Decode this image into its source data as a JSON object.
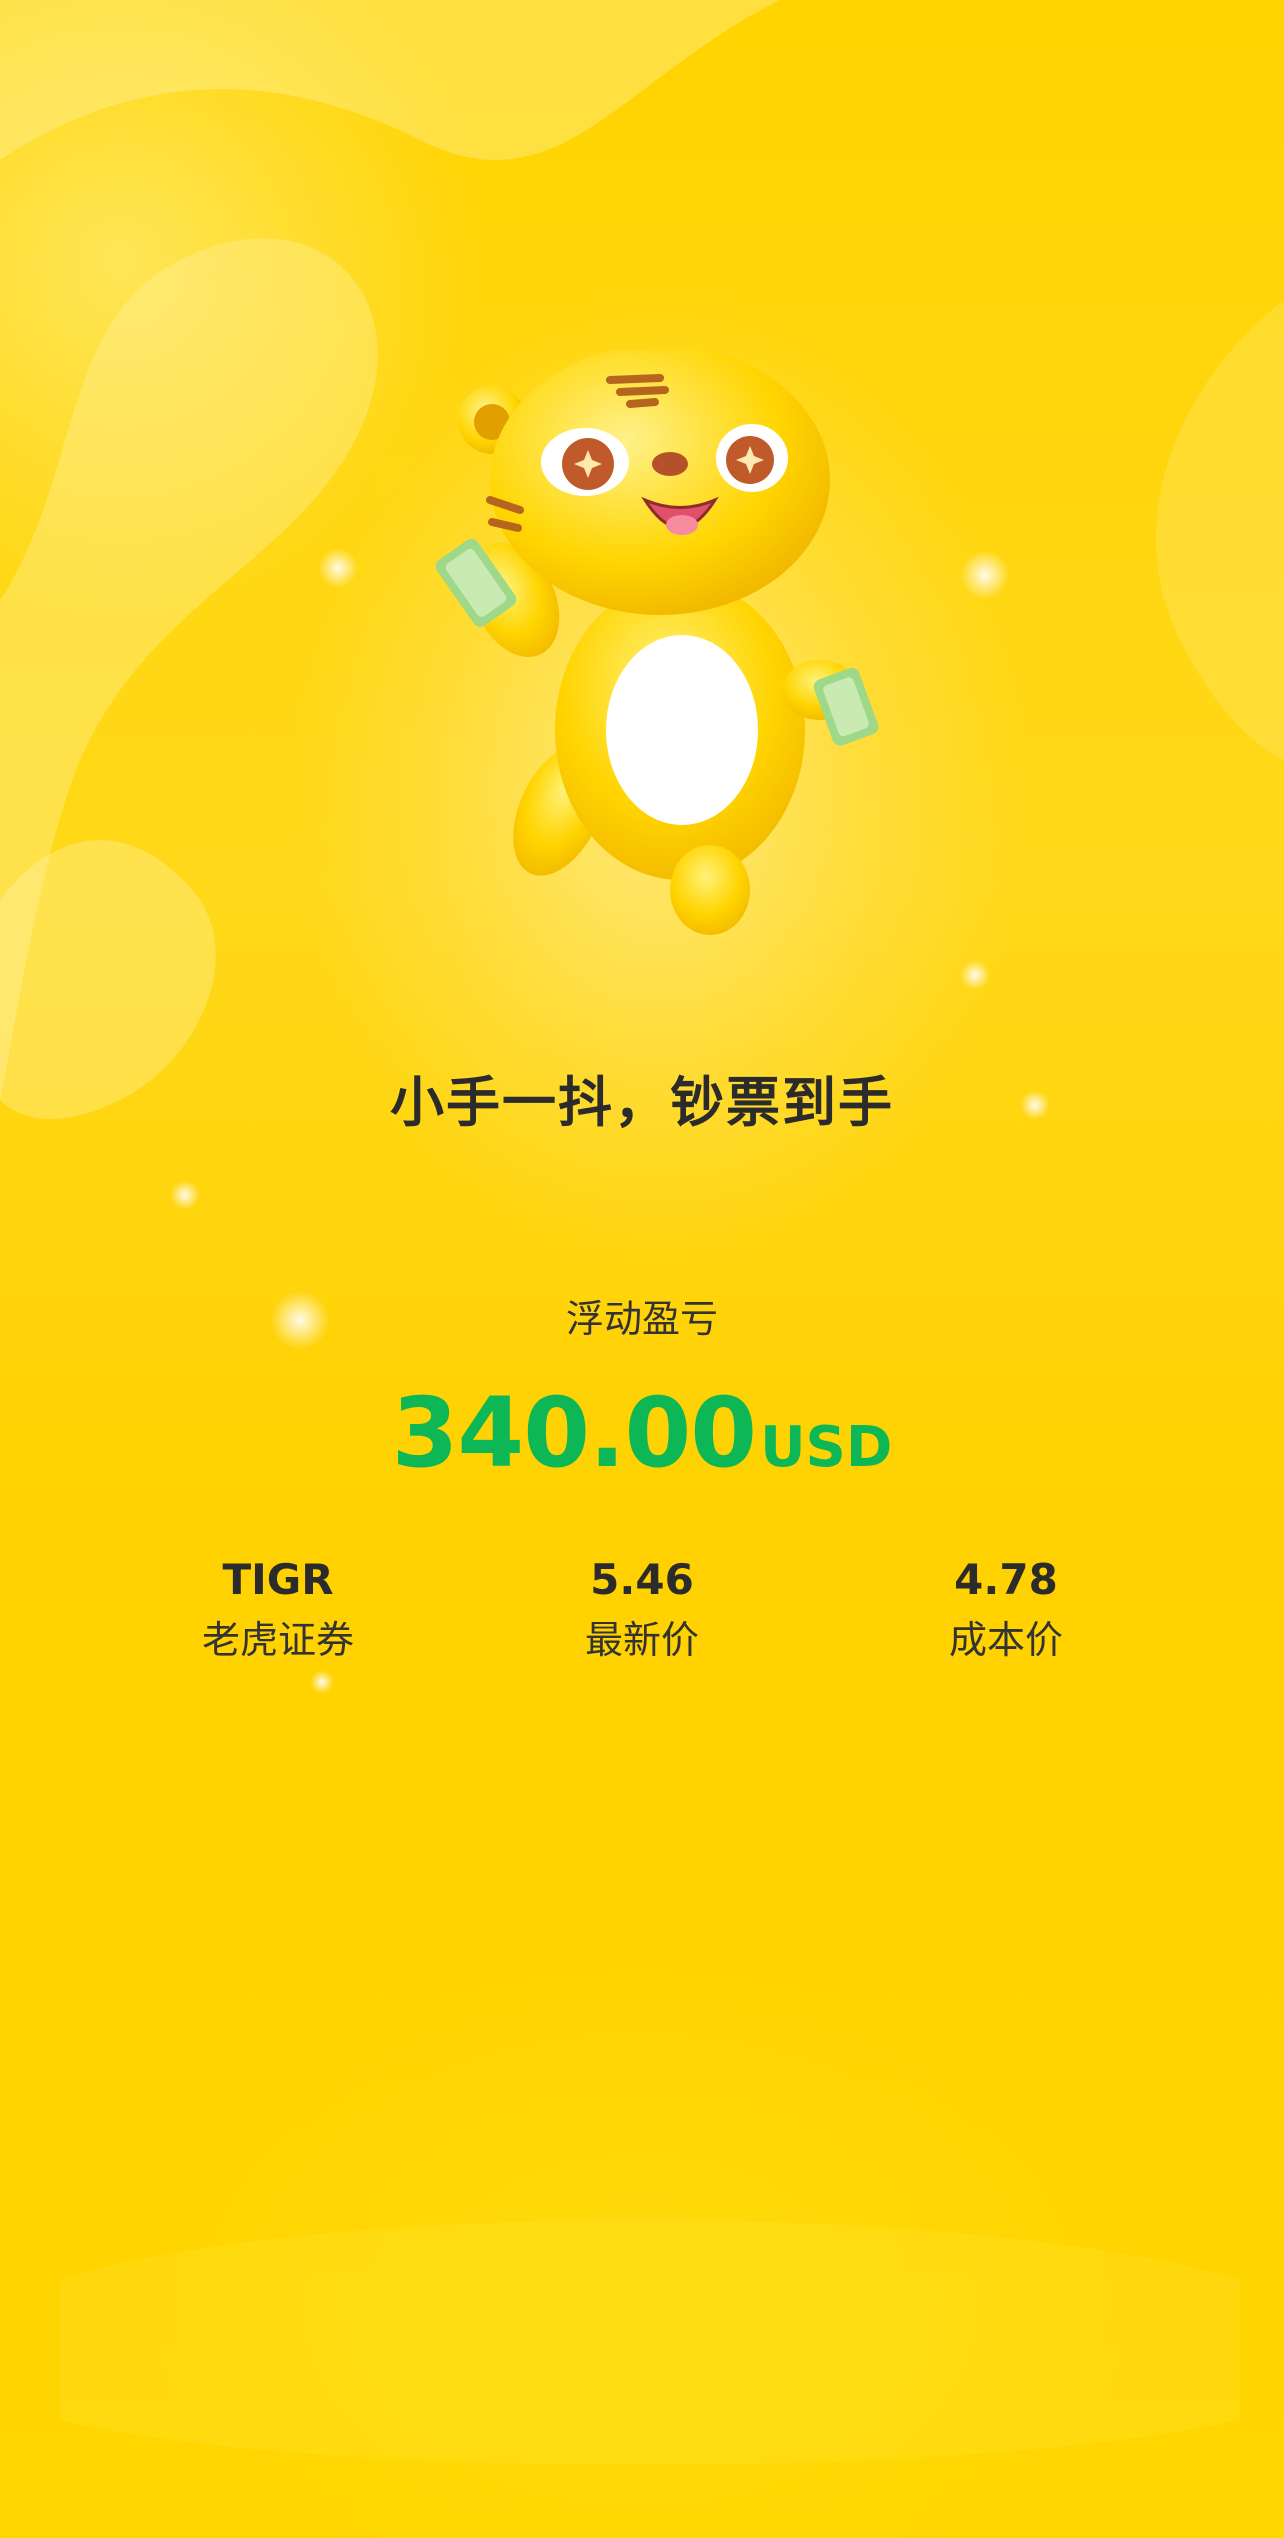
{
  "slogan": "小手一抖，钞票到手",
  "pnl": {
    "label": "浮动盈亏",
    "value": "340.00",
    "currency": "USD",
    "color": "#0DB755"
  },
  "stats": [
    {
      "value": "TIGR",
      "label": "老虎证券"
    },
    {
      "value": "5.46",
      "label": "最新价"
    },
    {
      "value": "4.78",
      "label": "成本价"
    }
  ],
  "colors": {
    "background": "#FFD600",
    "text": "#2B2B2B"
  },
  "illustration": "tiger-mascot-holding-cash"
}
